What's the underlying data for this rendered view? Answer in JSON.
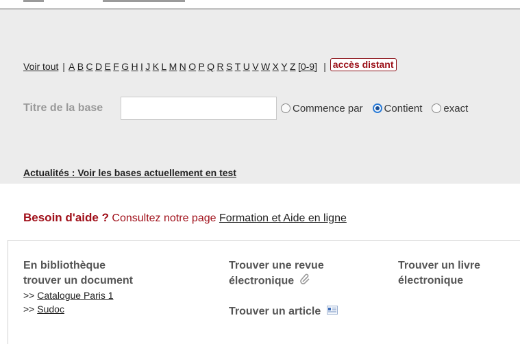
{
  "alpha_nav": {
    "voir_tout": "Voir tout",
    "separator": "|",
    "letters": [
      "A",
      "B",
      "C",
      "D",
      "E",
      "F",
      "G",
      "H",
      "I",
      "J",
      "K",
      "L",
      "M",
      "N",
      "O",
      "P",
      "Q",
      "R",
      "S",
      "T",
      "U",
      "V",
      "W",
      "X",
      "Y",
      "Z",
      "[0-9]"
    ],
    "acces_distant": "accès distant"
  },
  "search": {
    "label": "Titre de la base",
    "value": "",
    "options": [
      {
        "label": "Commence par",
        "checked": false
      },
      {
        "label": "Contient",
        "checked": true
      },
      {
        "label": "exact",
        "checked": false
      }
    ]
  },
  "news": {
    "link": "Actualités : Voir les bases actuellement en test"
  },
  "help": {
    "strong": "Besoin d'aide ?",
    "text": "Consultez notre page",
    "link": "Formation et Aide en ligne"
  },
  "columns": {
    "col1": {
      "title_line1": "En bibliothèque",
      "title_line2": "trouver un document",
      "prefix": ">>",
      "links": [
        "Catalogue Paris 1",
        "Sudoc"
      ]
    },
    "col2": {
      "title_line1": "Trouver une revue",
      "title_line2": "électronique",
      "article": "Trouver un article"
    },
    "col3": {
      "title_line1": "Trouver un livre",
      "title_line2": "électronique"
    }
  },
  "colors": {
    "accent_red": "#a0101a",
    "panel_gray": "#ececec",
    "radio_blue": "#2b7bd6"
  }
}
